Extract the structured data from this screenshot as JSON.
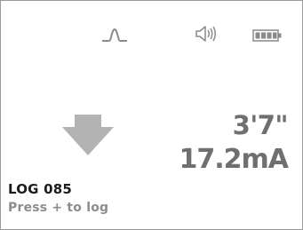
{
  "status_bar": {
    "icons": [
      "pulse-icon",
      "speaker-icon",
      "battery-icon"
    ],
    "battery_level": 1.0
  },
  "main": {
    "direction_icon": "down-arrow-icon",
    "depth": "3'7\"",
    "current": "17.2mA"
  },
  "log": {
    "label": "LOG 085",
    "hint": "Press + to log"
  },
  "colors": {
    "icon": "#8a8a8a",
    "arrow": "#b3b3b3",
    "readout": "#6f6f6f",
    "label": "#1c1c1c",
    "hint": "#8c8c8c"
  }
}
